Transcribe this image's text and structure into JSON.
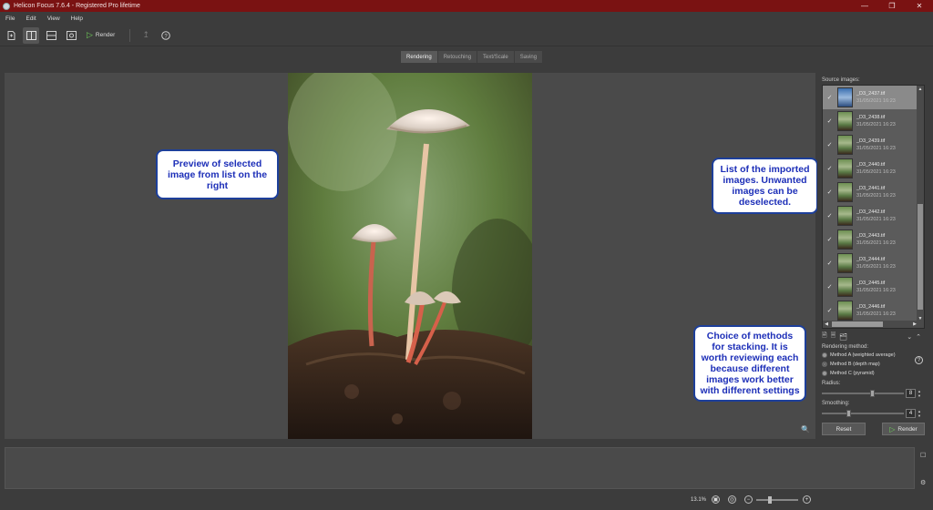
{
  "window": {
    "title": "Helicon Focus 7.6.4 - Registered Pro lifetime",
    "controls": [
      "minimize-icon",
      "restore-icon",
      "close-icon"
    ]
  },
  "menu": [
    "File",
    "Edit",
    "View",
    "Help"
  ],
  "toolbar": {
    "render_label": "Render"
  },
  "tabs": [
    "Rendering",
    "Retouching",
    "Text/Scale",
    "Saving"
  ],
  "active_tab": "Rendering",
  "source_images": {
    "label": "Source images:",
    "items": [
      {
        "name": "_D3_2437.tif",
        "date": "31/05/2021 16:23",
        "checked": true,
        "selected": true
      },
      {
        "name": "_D3_2438.tif",
        "date": "31/05/2021 16:23",
        "checked": true,
        "selected": false
      },
      {
        "name": "_D3_2439.tif",
        "date": "31/05/2021 16:23",
        "checked": true,
        "selected": false
      },
      {
        "name": "_D3_2440.tif",
        "date": "31/05/2021 16:23",
        "checked": true,
        "selected": false
      },
      {
        "name": "_D3_2441.tif",
        "date": "31/05/2021 16:23",
        "checked": true,
        "selected": false
      },
      {
        "name": "_D3_2442.tif",
        "date": "31/05/2021 16:23",
        "checked": true,
        "selected": false
      },
      {
        "name": "_D3_2443.tif",
        "date": "31/05/2021 16:23",
        "checked": true,
        "selected": false
      },
      {
        "name": "_D3_2444.tif",
        "date": "31/05/2021 16:23",
        "checked": true,
        "selected": false
      },
      {
        "name": "_D3_2445.tif",
        "date": "31/05/2021 16:23",
        "checked": true,
        "selected": false
      },
      {
        "name": "_D3_2446.tif",
        "date": "31/05/2021 16:23",
        "checked": true,
        "selected": false
      }
    ]
  },
  "rendering": {
    "method_label": "Rendering method:",
    "methods": [
      "Method A (weighted average)",
      "Method B (depth map)",
      "Method C (pyramid)"
    ],
    "selected_method": "Method B (depth map)",
    "radius_label": "Radius:",
    "radius": "8",
    "radius_fraction": 0.62,
    "smoothing_label": "Smoothing:",
    "smoothing": "4",
    "smoothing_fraction": 0.32,
    "reset_label": "Reset",
    "render_label": "Render"
  },
  "status": {
    "zoom": "13.1%",
    "zoom_fraction": 0.3
  },
  "callouts": {
    "preview": "Preview of selected image from list on the right",
    "list": "List of the imported images. Unwanted images can be deselected.",
    "methods": "Choice of methods for stacking. It is worth reviewing each because different images work better with different settings"
  }
}
